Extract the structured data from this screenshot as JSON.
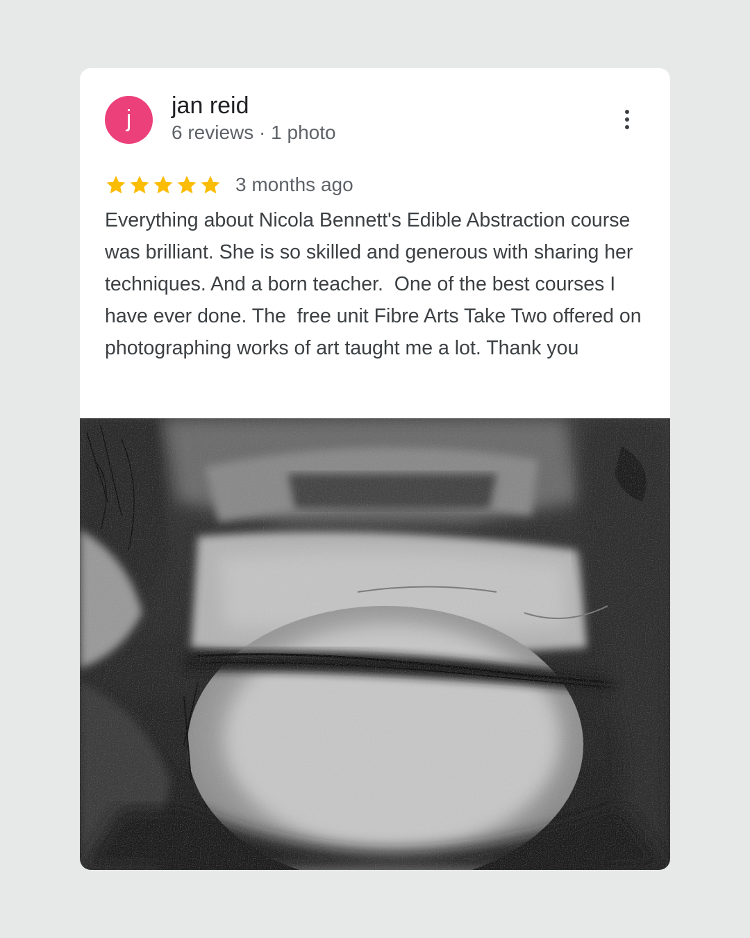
{
  "review": {
    "reviewer": {
      "avatar_letter": "j",
      "avatar_color": "#ec407a",
      "name": "jan reid",
      "meta": "6 reviews · 1 photo"
    },
    "menu_icon": "more-vert-icon",
    "rating": 5,
    "star_color": "#fbbc04",
    "date": "3 months ago",
    "text": "Everything about Nicola Bennett's Edible Abstraction course was brilliant. She is so skilled and generous with sharing her techniques. And a born teacher.  One of the best courses I have ever done. The  free unit Fibre Arts Take Two offered on photographing works of art taught me a lot. Thank you"
  },
  "photo": {
    "description_icon": "abstract-portrait-painting-image"
  }
}
